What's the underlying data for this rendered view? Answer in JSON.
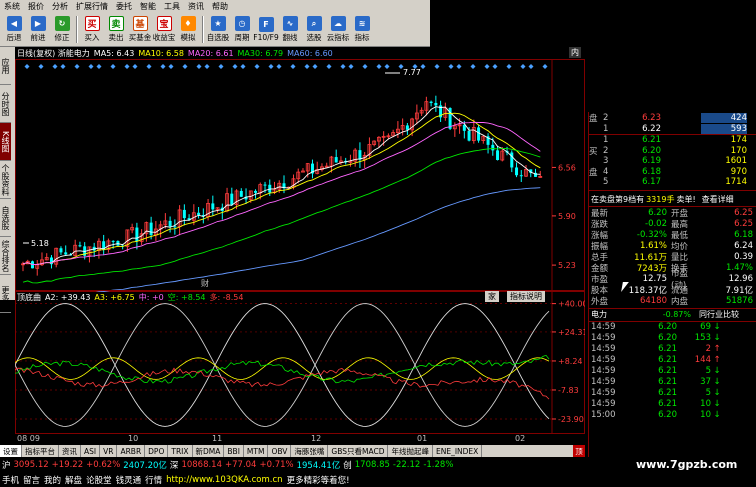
{
  "menubar": {
    "items": [
      "系统",
      "报价",
      "分析",
      "扩展行情",
      "委托",
      "智能",
      "工具",
      "资讯",
      "帮助"
    ]
  },
  "toolbar": {
    "buttons": [
      {
        "label": "后退",
        "icon": "back-arrow-icon",
        "color": "#2a6ac8"
      },
      {
        "label": "前进",
        "icon": "forward-arrow-icon",
        "color": "#2a6ac8"
      },
      {
        "label": "修正",
        "icon": "refresh-icon",
        "color": "#2a9a2a"
      },
      {
        "label": "买入",
        "icon": "buy-icon",
        "color": "#cc0000",
        "glyph": "买"
      },
      {
        "label": "卖出",
        "icon": "sell-icon",
        "color": "#008800",
        "glyph": "卖"
      },
      {
        "label": "买基金",
        "icon": "fund-icon",
        "color": "#cc4400",
        "glyph": "基"
      },
      {
        "label": "收益宝",
        "icon": "treasure-icon",
        "color": "#cc0000",
        "glyph": "宝"
      },
      {
        "label": "模拟",
        "icon": "simulate-icon",
        "color": "#ff8800"
      },
      {
        "label": "自选股",
        "icon": "watchlist-icon",
        "color": "#2a6ac8"
      },
      {
        "label": "周期",
        "icon": "period-icon",
        "color": "#2a6ac8"
      },
      {
        "label": "F10/F9",
        "icon": "f10-icon",
        "color": "#2a6ac8"
      },
      {
        "label": "翻线",
        "icon": "line-icon",
        "color": "#2a6ac8"
      },
      {
        "label": "选股",
        "icon": "filter-icon",
        "color": "#2a6ac8"
      },
      {
        "label": "云指标",
        "icon": "cloud-icon",
        "color": "#2a6ac8"
      },
      {
        "label": "指标",
        "icon": "indicator-icon",
        "color": "#2a6ac8"
      }
    ]
  },
  "lefttabs": [
    "应用",
    "分时图",
    "K线图",
    "个股资料",
    "自选股",
    "综合排名",
    "更多"
  ],
  "chart": {
    "stock": "日线(复权) 浙能电力",
    "ma5": "MA5: 6.43",
    "ma10": "MA10: 6.58",
    "ma20": "MA20: 6.61",
    "ma30": "MA30: 6.79",
    "ma60": "MA60: 6.60",
    "yticks": [
      "6.56",
      "5.90",
      "5.23"
    ],
    "high_label": "7.77",
    "low_label": "5.18",
    "fin_marker": "财",
    "corner": "内"
  },
  "chart_data": {
    "type": "candlestick",
    "y_ticks": [
      6.56,
      5.9,
      5.23
    ],
    "high": 7.77,
    "low": 5.18,
    "x_ticks": [
      "08 09",
      "10",
      "11",
      "12",
      "01",
      "02"
    ],
    "sub_indicator": {
      "name": "顶底曲",
      "a2": "A2: +39.43",
      "a3": "A3: +6.75",
      "zhong": "中: +0",
      "kong": "空: +8.54",
      "duo": "多: -8.54",
      "y_ticks": [
        "+40.00",
        "+24.31",
        "+8.24",
        "-7.83",
        "-23.90"
      ]
    }
  },
  "subchart": {
    "btn1": "家",
    "btn2": "指标说明"
  },
  "xaxis": [
    "08 09",
    "10",
    "11",
    "12",
    "01",
    "02"
  ],
  "btabs": [
    "设置",
    "指标平台",
    "资讯",
    "ASI",
    "VR",
    "ARBR",
    "DPO",
    "TRIX",
    "新DMA",
    "BBI",
    "MTM",
    "OBV",
    "海豚张嘴",
    "GBS只看MACD",
    "年线抛起峰",
    "ENE_INDEX"
  ],
  "btab_red": "顶",
  "status": {
    "sh_label": "沪",
    "sh_val": "3095.12",
    "sh_chg": "+19.22",
    "sh_pct": "+0.62%",
    "sh_amt": "2407.20亿",
    "sz_label": "深",
    "sz_val": "10868.14",
    "sz_chg": "+77.04",
    "sz_pct": "+0.71%",
    "sz_amt": "1954.41亿",
    "cy_label": "创",
    "cy_val": "1708.85",
    "cy_chg": "-22.12",
    "cy_pct": "-1.28%"
  },
  "status2": {
    "items": [
      "手机",
      "留言",
      "我的",
      "解盘",
      "论股堂",
      "钱灵通",
      "行情"
    ],
    "url": "http://www.103QKA.com.cn",
    "slogan": "更多精彩等着您!"
  },
  "book": {
    "sell_label": "卖",
    "buy_label": "买",
    "pan": "盘",
    "sell": [
      {
        "lvl": "2",
        "price": "6.23",
        "vol": "424"
      },
      {
        "lvl": "1",
        "price": "6.22",
        "vol": "593"
      }
    ],
    "buy": [
      {
        "lvl": "1",
        "price": "6.21",
        "vol": "174"
      },
      {
        "lvl": "2",
        "price": "6.20",
        "vol": "170"
      },
      {
        "lvl": "3",
        "price": "6.19",
        "vol": "1601"
      },
      {
        "lvl": "4",
        "price": "6.18",
        "vol": "970"
      },
      {
        "lvl": "5",
        "price": "6.17",
        "vol": "1714"
      }
    ],
    "summary": "在卖盘第9档有",
    "summary_vol": "3319手",
    "summary_btn1": "卖单!",
    "summary_btn2": "查看详细",
    "info": [
      {
        "k": "最新",
        "v": "6.20",
        "k2": "开盘",
        "v2": "6.25"
      },
      {
        "k": "涨跌",
        "v": "-0.02",
        "k2": "最高",
        "v2": "6.25"
      },
      {
        "k": "涨幅",
        "v": "-0.32%",
        "k2": "最低",
        "v2": "6.18"
      },
      {
        "k": "振幅",
        "v": "1.61%",
        "k2": "均价",
        "v2": "6.24"
      },
      {
        "k": "总手",
        "v": "11.61万",
        "k2": "量比",
        "v2": "0.39"
      },
      {
        "k": "金额",
        "v": "7243万",
        "k2": "换手",
        "v2": "1.47%"
      },
      {
        "k": "市盈",
        "v": "12.75",
        "k2": "市盈(动)",
        "v2": "12.96"
      },
      {
        "k": "股本",
        "v": "118.37亿",
        "k2": "流通",
        "v2": "7.91亿"
      },
      {
        "k": "外盘",
        "v": "64180",
        "k2": "内盘",
        "v2": "51876"
      }
    ],
    "industry_label": "电力",
    "industry_pct": "-0.87%",
    "industry_btn": "同行业比较",
    "ticks": [
      {
        "t": "14:59",
        "p": "6.20",
        "v": "69",
        "dir": "down"
      },
      {
        "t": "14:59",
        "p": "6.20",
        "v": "153",
        "dir": "down"
      },
      {
        "t": "14:59",
        "p": "6.21",
        "v": "2",
        "dir": "up"
      },
      {
        "t": "14:59",
        "p": "6.21",
        "v": "144",
        "dir": "up"
      },
      {
        "t": "14:59",
        "p": "6.21",
        "v": "5",
        "dir": "down"
      },
      {
        "t": "14:59",
        "p": "6.21",
        "v": "37",
        "dir": "down"
      },
      {
        "t": "14:59",
        "p": "6.21",
        "v": "5",
        "dir": "down"
      },
      {
        "t": "14:59",
        "p": "6.21",
        "v": "10",
        "dir": "down"
      },
      {
        "t": "15:00",
        "p": "6.20",
        "v": "10",
        "dir": "down"
      }
    ]
  },
  "watermark": "www.7gpzb.com"
}
